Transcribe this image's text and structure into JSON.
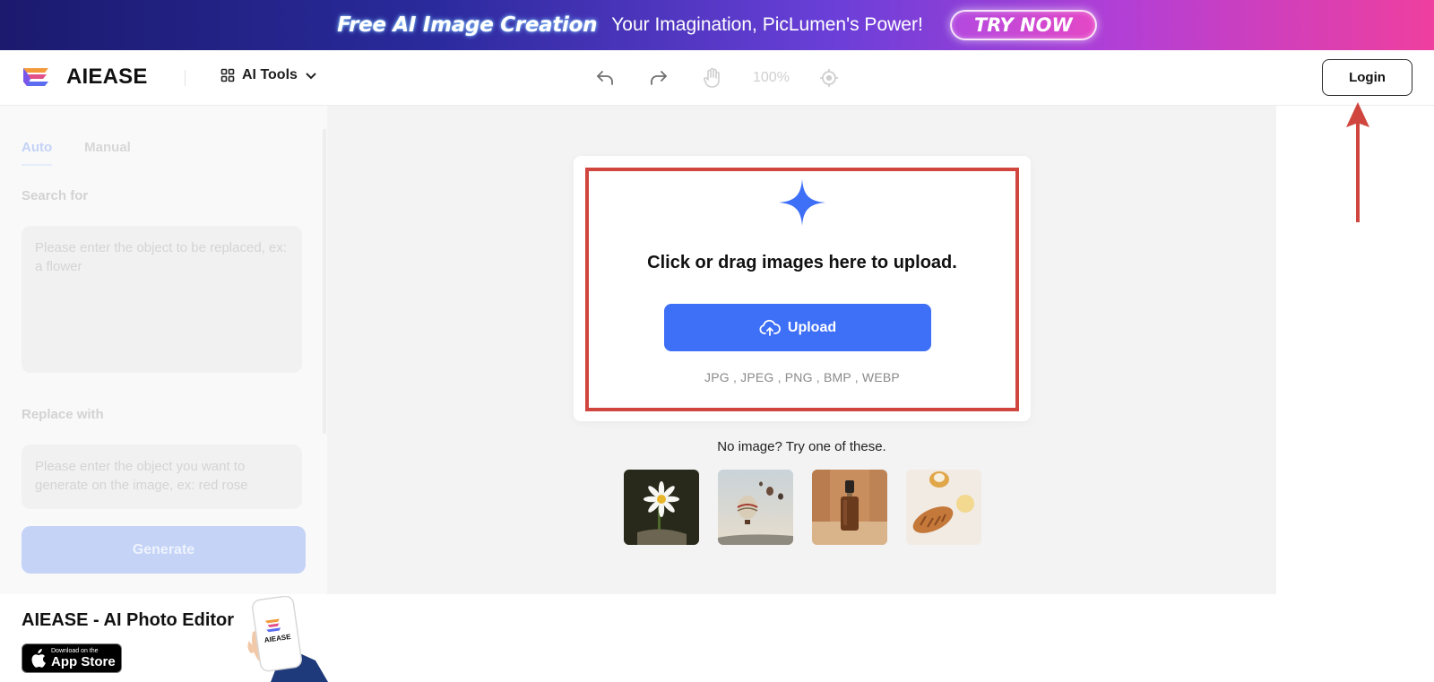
{
  "promo": {
    "title": "Free AI Image Creation",
    "subtitle": "Your Imagination, PicLumen's Power!",
    "cta": "TRY NOW"
  },
  "header": {
    "logo_text": "AIEASE",
    "ai_tools_label": "AI Tools",
    "zoom_level": "100%",
    "login_label": "Login"
  },
  "left_panel": {
    "tabs": [
      "Auto",
      "Manual"
    ],
    "search_label": "Search for",
    "search_placeholder": "Please enter the object to be replaced, ex: a flower",
    "replace_label": "Replace with",
    "replace_placeholder": "Please enter the object you want to generate on the image, ex: red rose",
    "generate_label": "Generate"
  },
  "upload": {
    "prompt": "Click or drag images here to upload.",
    "button_label": "Upload",
    "formats": "JPG , JPEG , PNG , BMP , WEBP",
    "try_text": "No image? Try one of these."
  },
  "samples": [
    "daisy-flower",
    "hot-air-balloons",
    "serum-bottle",
    "bread-and-cream"
  ],
  "footer": {
    "app_title": "AIEASE - AI Photo Editor",
    "appstore_small": "Download on the",
    "appstore_big": "App Store",
    "phone_logo_text": "AIEASE"
  },
  "colors": {
    "accent": "#3d6ff7",
    "highlight": "#d0463f",
    "arrow": "#d0463f"
  }
}
